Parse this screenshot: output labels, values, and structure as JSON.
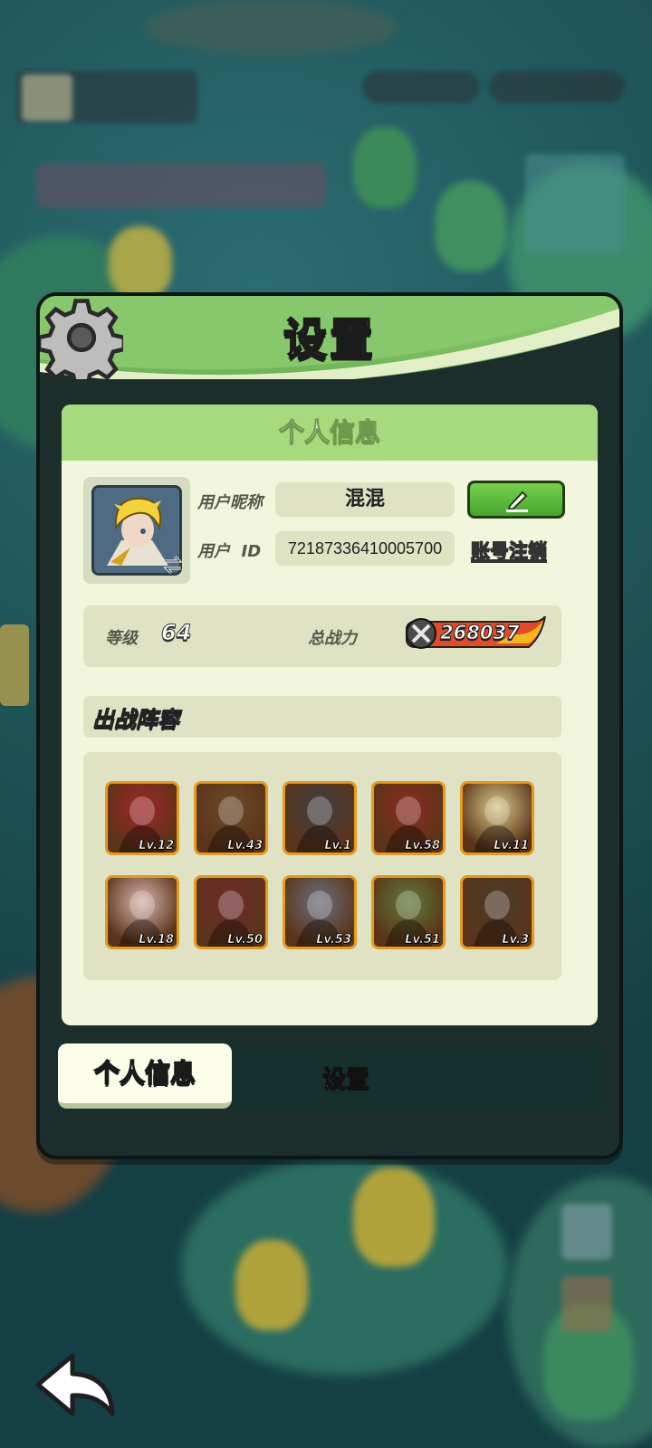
{
  "panel": {
    "title": "设置",
    "card_title": "个人信息"
  },
  "profile": {
    "nickname_label": "用户昵称",
    "nickname": "混混",
    "id_label": "用户  ID",
    "user_id": "72187336410005700",
    "cancel_account": "账号注销"
  },
  "stats": {
    "level_label": "等级",
    "level": "64",
    "power_label": "总战力",
    "power": "268037"
  },
  "team": {
    "title": "出战阵容",
    "heroes": [
      {
        "lv": "Lv.12",
        "color": "#a3242a"
      },
      {
        "lv": "Lv.43",
        "color": "#6b4a2a"
      },
      {
        "lv": "Lv.1",
        "color": "#3e3f46"
      },
      {
        "lv": "Lv.58",
        "color": "#8a2b21"
      },
      {
        "lv": "Lv.11",
        "color": "#d8c98a"
      },
      {
        "lv": "Lv.18",
        "color": "#d7b6b0"
      },
      {
        "lv": "Lv.50",
        "color": "#6e2a2e"
      },
      {
        "lv": "Lv.53",
        "color": "#6a6f7e"
      },
      {
        "lv": "Lv.51",
        "color": "#5f7a3b"
      },
      {
        "lv": "Lv.3",
        "color": "#4a3a2a"
      }
    ]
  },
  "tabs": {
    "active": "个人信息",
    "inactive": "设置"
  },
  "icons": {
    "gear": "gear-icon",
    "edit": "pencil-icon",
    "back": "back-arrow-icon",
    "power": "crossed-swords-icon"
  },
  "colors": {
    "header_green": "#8fcf74",
    "card_bg": "#f1f6dc",
    "edit_green": "#45a42d",
    "hero_border": "#e79a1d"
  }
}
